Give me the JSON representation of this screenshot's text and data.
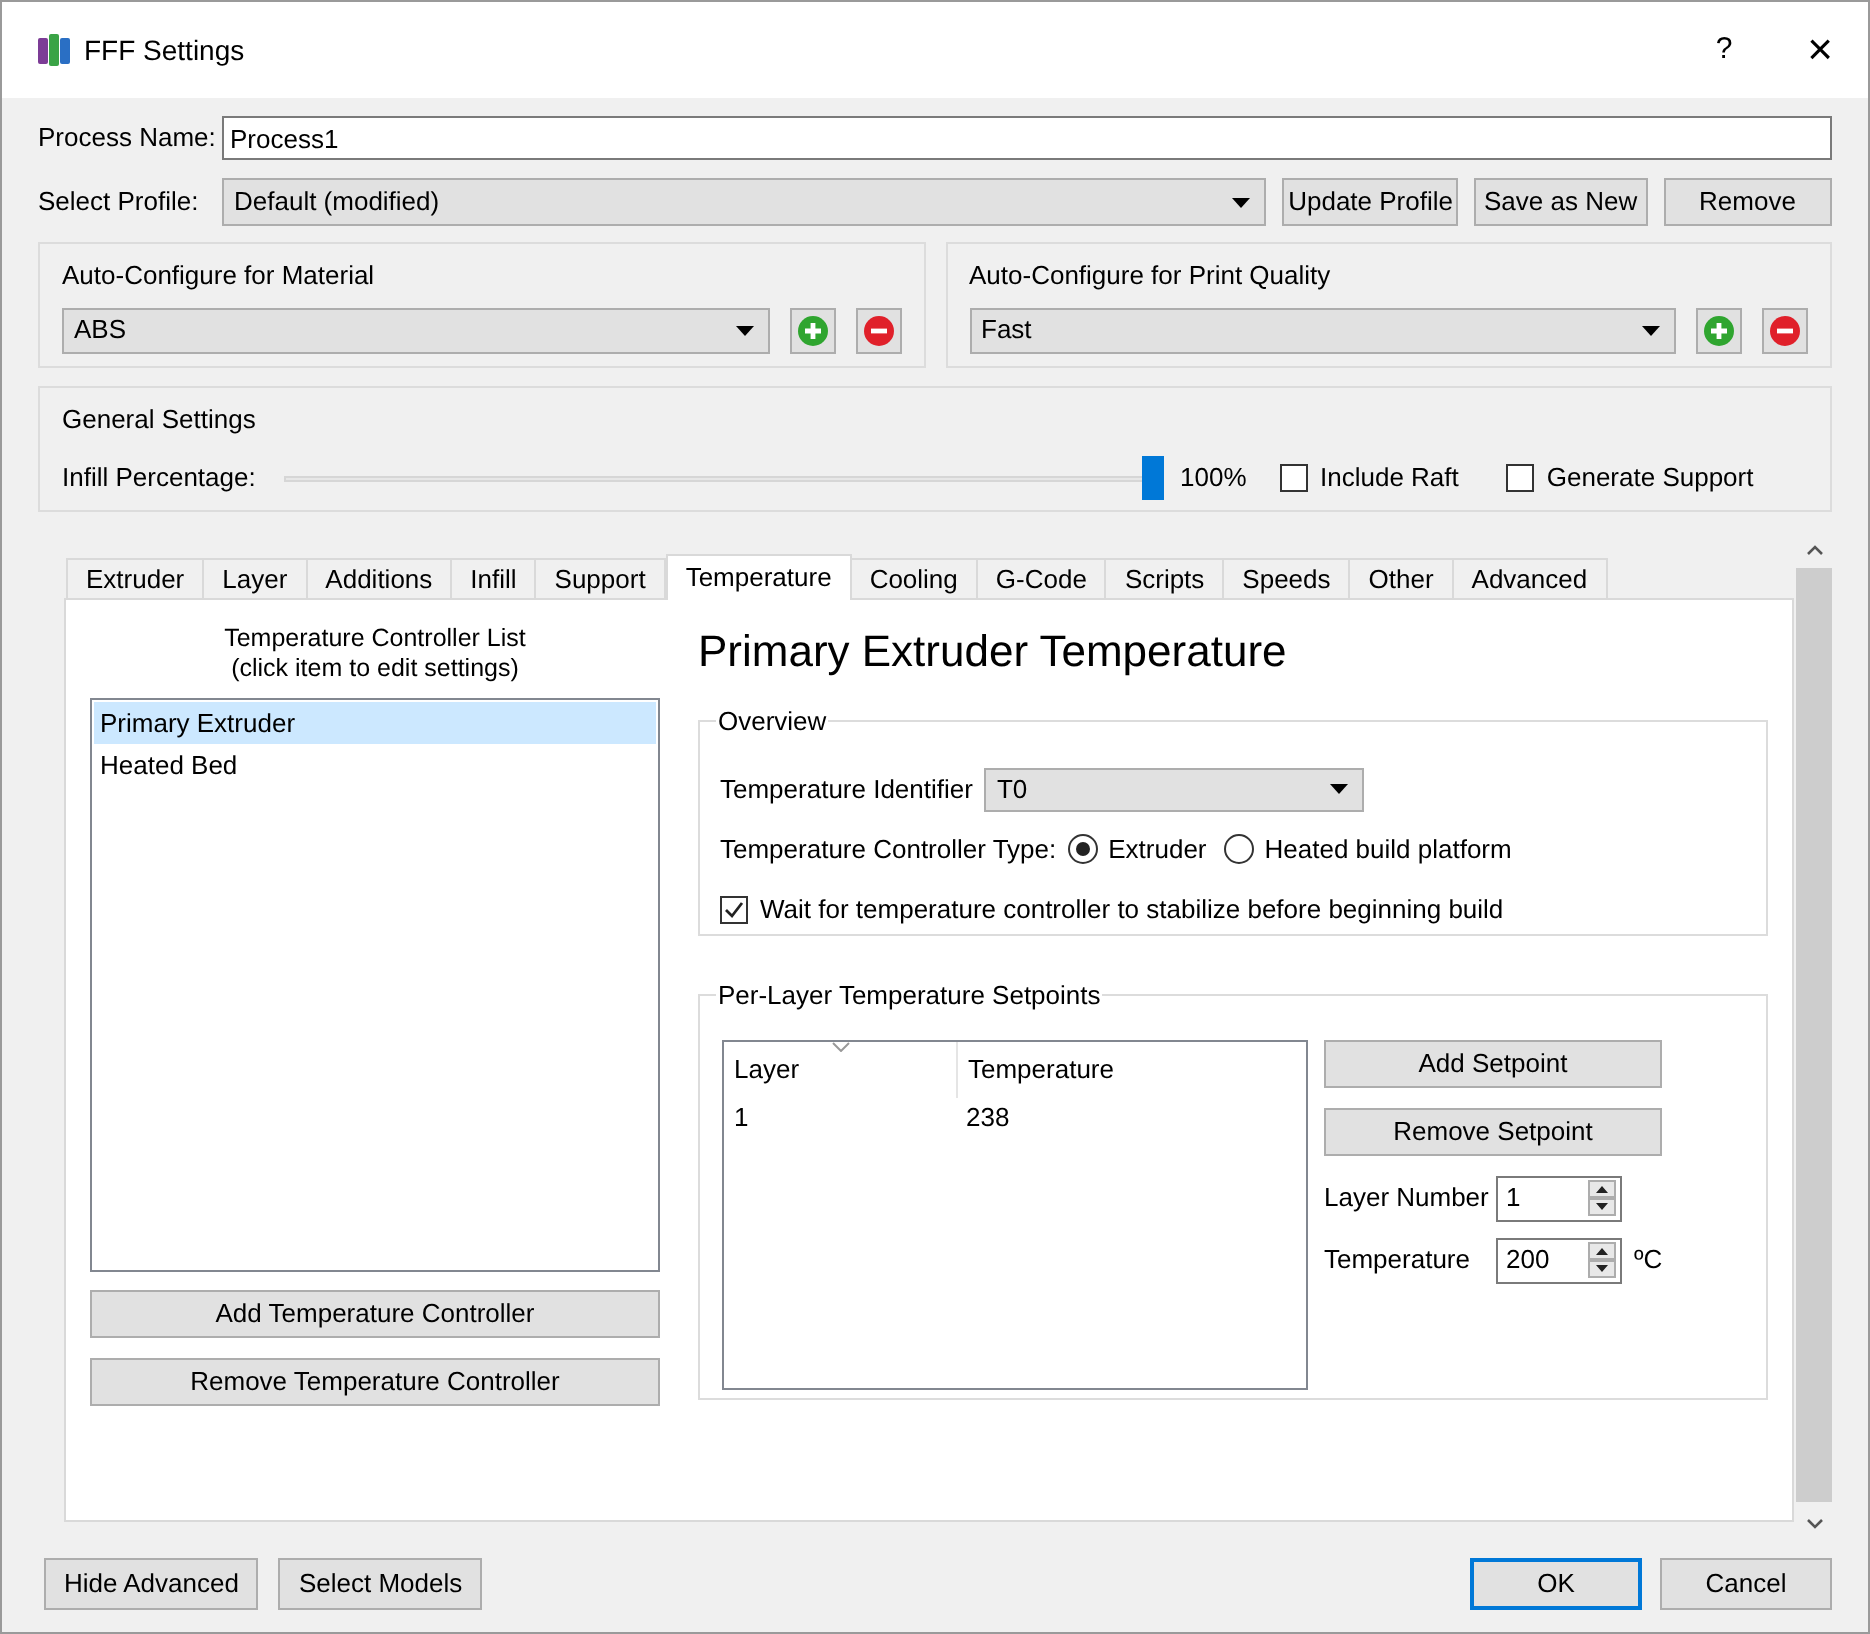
{
  "window": {
    "title": "FFF Settings",
    "help": "?",
    "close": "×"
  },
  "process_name": {
    "label": "Process Name:",
    "value": "Process1"
  },
  "profile": {
    "label": "Select Profile:",
    "value": "Default (modified)",
    "buttons": [
      "Update Profile",
      "Save as New",
      "Remove"
    ]
  },
  "auto_configure": [
    {
      "title": "Auto-Configure for Material",
      "value": "ABS"
    },
    {
      "title": "Auto-Configure for Print Quality",
      "value": "Fast"
    }
  ],
  "general": {
    "title": "General Settings",
    "infill_label": "Infill Percentage:",
    "infill": {
      "level": 1.0
    },
    "infill_reading": "100%",
    "options": [
      {
        "label": "Include Raft",
        "checked": false
      },
      {
        "label": "Generate Support",
        "checked": false
      }
    ]
  },
  "tabs": [
    {
      "label": "Extruder",
      "selected": false
    },
    {
      "label": "Layer",
      "selected": false
    },
    {
      "label": "Additions",
      "selected": false
    },
    {
      "label": "Infill",
      "selected": false
    },
    {
      "label": "Support",
      "selected": false
    },
    {
      "label": "Temperature",
      "selected": true
    },
    {
      "label": "Cooling",
      "selected": false
    },
    {
      "label": "G-Code",
      "selected": false
    },
    {
      "label": "Scripts",
      "selected": false
    },
    {
      "label": "Speeds",
      "selected": false
    },
    {
      "label": "Other",
      "selected": false
    },
    {
      "label": "Advanced",
      "selected": false
    }
  ],
  "controller_list": {
    "caption": [
      "Temperature Controller List",
      "(click item to edit settings)"
    ],
    "items": [
      {
        "label": "Primary Extruder",
        "selected": true
      },
      {
        "label": "Heated Bed",
        "selected": false
      }
    ],
    "buttons": [
      "Add Temperature Controller",
      "Remove Temperature Controller"
    ]
  },
  "heading": "Primary Extruder Temperature",
  "overview": {
    "title": "Overview",
    "identifier_label": "Temperature Identifier",
    "identifier_value": "T0",
    "type_label": "Temperature Controller Type:",
    "type_options": [
      {
        "label": "Extruder",
        "selected": true
      },
      {
        "label": "Heated build platform",
        "selected": false
      }
    ],
    "wait": {
      "label": "Wait for temperature controller to stabilize before beginning build",
      "checked": true
    }
  },
  "setpoints": {
    "title": "Per-Layer Temperature Setpoints",
    "columns": [
      "Layer",
      "Temperature"
    ],
    "rows": [
      [
        "1",
        "238"
      ]
    ],
    "buttons": [
      "Add Setpoint",
      "Remove Setpoint"
    ],
    "layer_number": {
      "label": "Layer Number",
      "value": "1"
    },
    "temperature": {
      "label": "Temperature",
      "value": "200",
      "unit": "ºC"
    }
  },
  "footer": {
    "left": [
      "Hide Advanced",
      "Select Models"
    ],
    "right": [
      {
        "label": "OK",
        "is_default": true
      },
      {
        "label": "Cancel",
        "is_default": false
      }
    ]
  }
}
